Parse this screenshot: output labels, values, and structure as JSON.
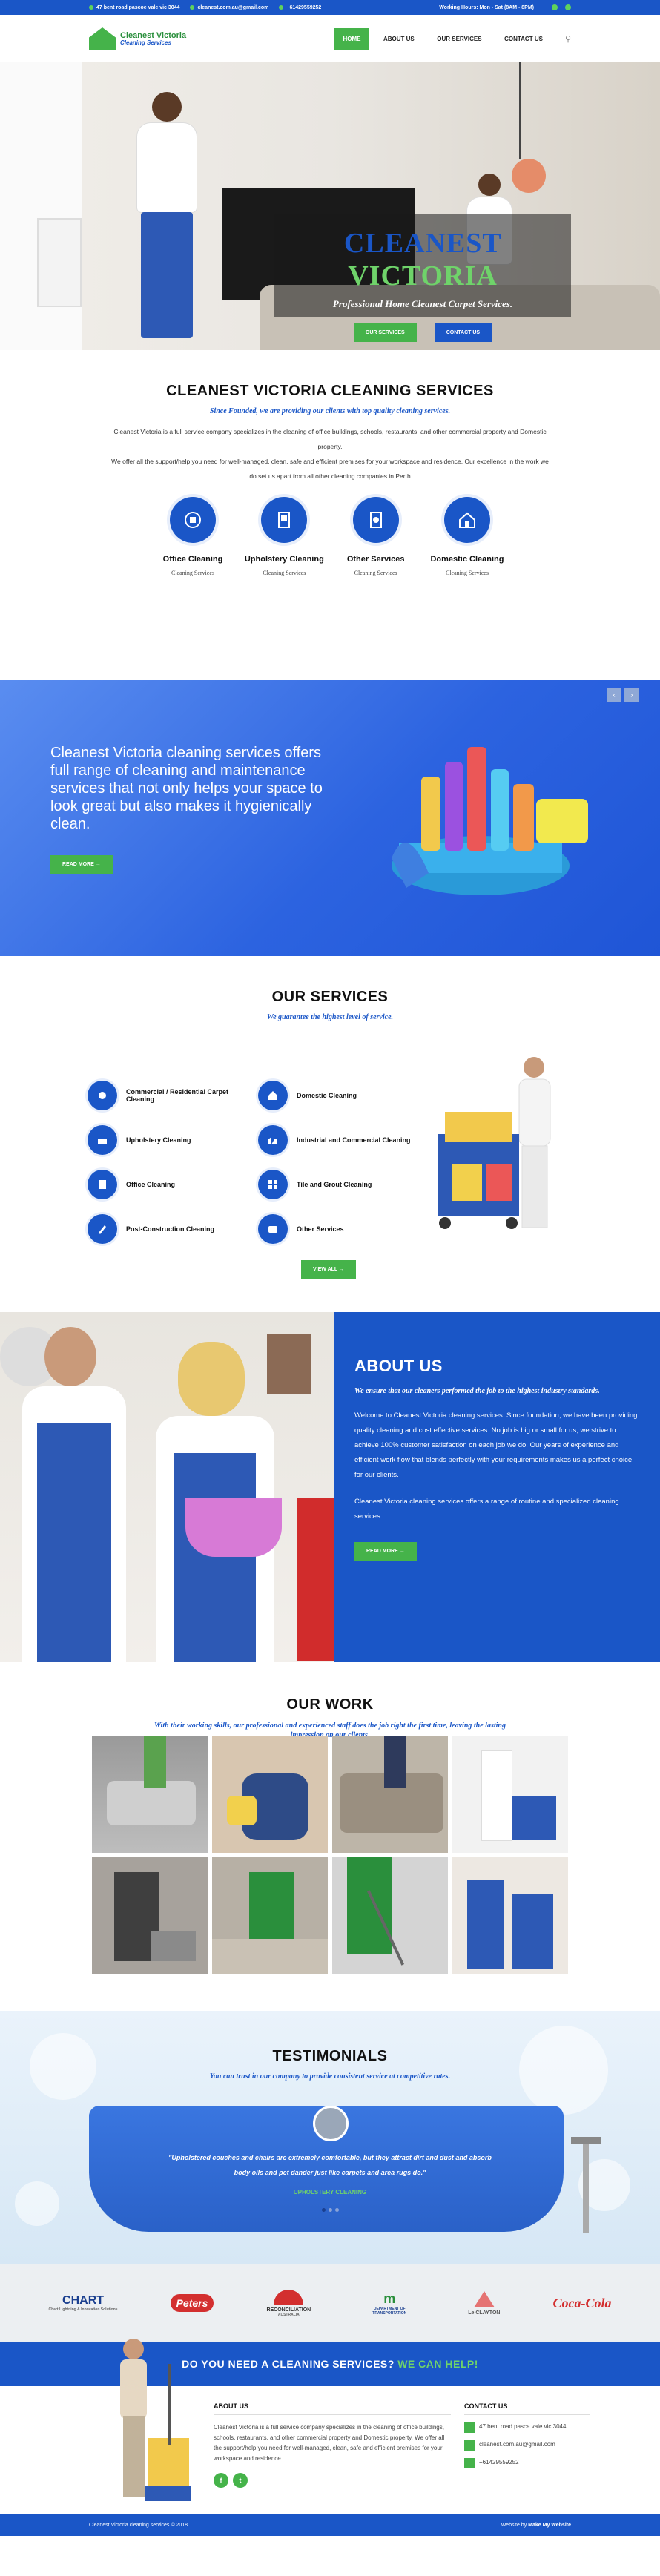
{
  "topbar": {
    "address": "47 bent road pascoe vale vic 3044",
    "email": "cleanest.com.au@gmail.com",
    "phone": "+61429559252",
    "hours": "Working Hours: Mon - Sat (8AM - 8PM)"
  },
  "logo": {
    "line1": "Cleanest Victoria",
    "line2": "Cleaning Services"
  },
  "nav": {
    "items": [
      "HOME",
      "ABOUT US",
      "OUR SERVICES",
      "CONTACT US"
    ],
    "active": "HOME"
  },
  "hero": {
    "title_a": "CLEANEST",
    "title_b": "VICTORIA",
    "subtitle": "Professional Home Cleanest Carpet Services.",
    "btn1": "OUR SERVICES",
    "btn2": "CONTACT US"
  },
  "intro": {
    "title": "CLEANEST VICTORIA CLEANING SERVICES",
    "subtitle": "Since Founded, we are providing our clients with top quality cleaning services.",
    "p1": "Cleanest Victoria is a full service company specializes in the cleaning of office buildings, schools, restaurants, and other commercial property and Domestic property.",
    "p2": "We offer all the support/help you need for well-managed, clean, safe and efficient premises for your workspace and residence. Our excellence in the work we do set us apart from all other cleaning companies in Perth",
    "cards": [
      {
        "title": "Office Cleaning",
        "desc": "Cleaning Services"
      },
      {
        "title": "Upholstery Cleaning",
        "desc": "Cleaning Services"
      },
      {
        "title": "Other Services",
        "desc": "Cleaning Services"
      },
      {
        "title": "Domestic Cleaning",
        "desc": "Cleaning Services"
      }
    ]
  },
  "banner": {
    "text": "Cleanest Victoria cleaning services offers full range of cleaning and maintenance services that not only helps your space to look great but also makes it hygienically clean.",
    "button": "READ MORE",
    "prev": "‹",
    "next": "›"
  },
  "services": {
    "title": "OUR SERVICES",
    "subtitle": "We guarantee the highest level of service.",
    "items": [
      "Commercial / Residential Carpet Cleaning",
      "Domestic Cleaning",
      "Upholstery Cleaning",
      "Industrial and Commercial Cleaning",
      "Office Cleaning",
      "Tile and Grout Cleaning",
      "Post-Construction Cleaning",
      "Other Services"
    ],
    "button": "VIEW ALL"
  },
  "about": {
    "title": "ABOUT US",
    "quote": "We ensure that our cleaners performed the job to the highest industry standards.",
    "p1": "Welcome to Cleanest Victoria cleaning services. Since foundation, we have been providing quality cleaning and cost effective services. No job is big or small for us, we strive to achieve 100% customer satisfaction on each job we do. Our years of experience and efficient work flow that blends perfectly with your requirements makes us a perfect choice for our clients.",
    "p2": "Cleanest Victoria cleaning services offers a range of routine and specialized cleaning services.",
    "button": "READ MORE"
  },
  "work": {
    "title": "OUR WORK",
    "subtitle": "With their working skills, our professional and experienced staff does the job right the first time, leaving the lasting impression on our clients."
  },
  "testimonials": {
    "title": "TESTIMONIALS",
    "subtitle": "You can trust in our company to provide consistent service at competitive rates.",
    "quote": "\"Upholstered couches and chairs are extremely comfortable, but they attract dirt and dust and absorb body oils and pet dander just like carpets and area rugs do.\"",
    "author": "UPHOLSTERY CLEANING"
  },
  "logos": [
    {
      "name": "CHART",
      "sub": "Chart Lightning & Innovation Solutions",
      "color": "#1a3f8f"
    },
    {
      "name": "Peters",
      "sub": "",
      "color": "#d32f2f"
    },
    {
      "name": "RECONCILIATION",
      "sub": "AUSTRALIA",
      "color": "#333333"
    },
    {
      "name": "DEPARTMENT OF TRANSPORTATION",
      "sub": "",
      "color": "#1a3f8f"
    },
    {
      "name": "Le CLAYTON",
      "sub": "",
      "color": "#555555"
    },
    {
      "name": "Coca-Cola",
      "sub": "",
      "color": "#d32f2f"
    }
  ],
  "cta": {
    "text": "DO YOU NEED A CLEANING SERVICES?",
    "highlight": "WE CAN HELP!"
  },
  "footer": {
    "about_title": "ABOUT US",
    "about_text": "Cleanest Victoria is a full service company specializes in the cleaning of office buildings, schools, restaurants, and other commercial property and Domestic property. We offer all the support/help you need for well-managed, clean, safe and efficient premises for your workspace and residence.",
    "contact_title": "CONTACT US",
    "address": "47 bent road pasce vale vic 3044",
    "email": "cleanest.com.au@gmail.com",
    "phone": "+61429559252",
    "social": [
      "f",
      "t"
    ]
  },
  "bottombar": {
    "copyright": "Cleanest Victoria cleaning services © 2018",
    "credit": "Website by",
    "credit_brand": "Make My Website"
  },
  "colors": {
    "blue": "#1a56c7",
    "green": "#45b34a"
  }
}
